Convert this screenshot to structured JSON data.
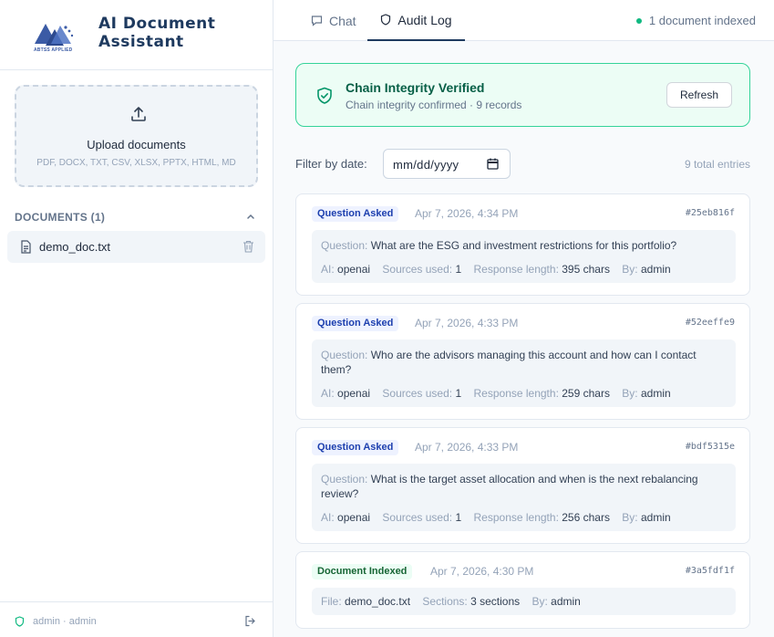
{
  "app": {
    "title": "AI Document Assistant",
    "logo_text": "ABTSS APPLIED"
  },
  "sidebar": {
    "upload": {
      "title": "Upload documents",
      "formats": "PDF, DOCX, TXT, CSV, XLSX, PPTX, HTML, MD"
    },
    "documents_label": "DOCUMENTS (1)",
    "documents": [
      {
        "name": "demo_doc.txt"
      }
    ],
    "user": "admin · admin"
  },
  "topbar": {
    "tabs": [
      {
        "label": "Chat",
        "icon": "chat-icon"
      },
      {
        "label": "Audit Log",
        "icon": "shield-icon",
        "active": true
      }
    ],
    "status": "1 document indexed"
  },
  "integrity": {
    "title": "Chain Integrity Verified",
    "subtitle": "Chain integrity confirmed · 9 records",
    "refresh_label": "Refresh"
  },
  "filter": {
    "label": "Filter by date:",
    "placeholder": "mm/dd/yyyy",
    "total": "9 total entries"
  },
  "entries": [
    {
      "type": "Question Asked",
      "time": "Apr 7, 2026, 4:34 PM",
      "hash": "#25eb816f",
      "question_key": "Question:",
      "question": "What are the ESG and investment restrictions for this portfolio?",
      "ai_key": "AI:",
      "ai": "openai",
      "sources_key": "Sources used:",
      "sources": "1",
      "length_key": "Response length:",
      "length": "395 chars",
      "by_key": "By:",
      "by": "admin"
    },
    {
      "type": "Question Asked",
      "time": "Apr 7, 2026, 4:33 PM",
      "hash": "#52eeffe9",
      "question_key": "Question:",
      "question": "Who are the advisors managing this account and how can I contact them?",
      "ai_key": "AI:",
      "ai": "openai",
      "sources_key": "Sources used:",
      "sources": "1",
      "length_key": "Response length:",
      "length": "259 chars",
      "by_key": "By:",
      "by": "admin"
    },
    {
      "type": "Question Asked",
      "time": "Apr 7, 2026, 4:33 PM",
      "hash": "#bdf5315e",
      "question_key": "Question:",
      "question": "What is the target asset allocation and when is the next rebalancing review?",
      "ai_key": "AI:",
      "ai": "openai",
      "sources_key": "Sources used:",
      "sources": "1",
      "length_key": "Response length:",
      "length": "256 chars",
      "by_key": "By:",
      "by": "admin"
    },
    {
      "type": "Document Indexed",
      "time": "Apr 7, 2026, 4:30 PM",
      "hash": "#3a5fdf1f",
      "file_key": "File:",
      "file": "demo_doc.txt",
      "sections_key": "Sections:",
      "sections": "3 sections",
      "by_key": "By:",
      "by": "admin"
    }
  ]
}
